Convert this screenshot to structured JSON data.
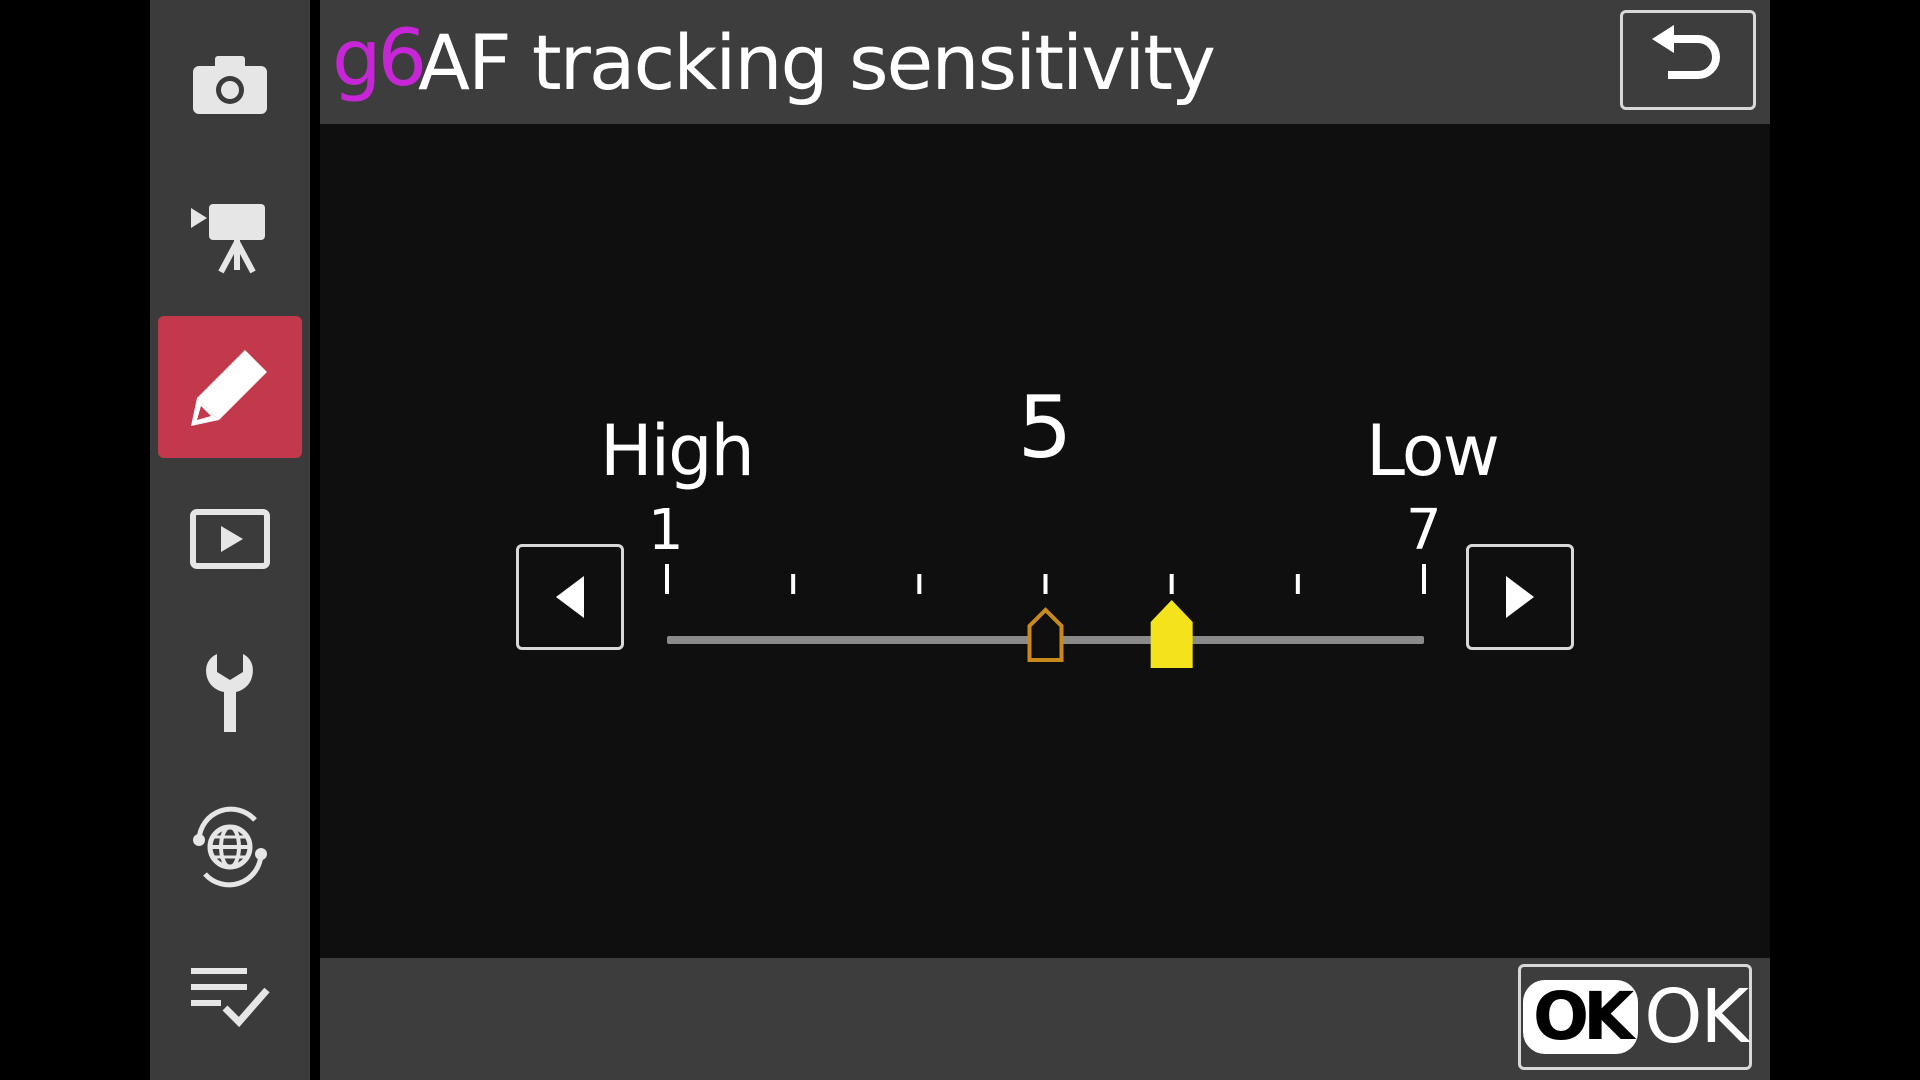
{
  "sidebar": {
    "items": [
      {
        "name": "camera-icon",
        "active": false
      },
      {
        "name": "movie-camera-icon",
        "active": false
      },
      {
        "name": "pencil-icon",
        "active": true
      },
      {
        "name": "playback-icon",
        "active": false
      },
      {
        "name": "wrench-icon",
        "active": false
      },
      {
        "name": "network-globe-icon",
        "active": false
      },
      {
        "name": "my-menu-icon",
        "active": false
      }
    ],
    "active_color": "#c1394b"
  },
  "header": {
    "code": "g6",
    "title": "AF tracking sensitivity",
    "code_color": "#c626d6",
    "back_icon": "return-arrow-icon"
  },
  "slider": {
    "label_high": "High",
    "label_low": "Low",
    "min_label": "1",
    "max_label": "7",
    "min": 1,
    "max": 7,
    "current_value": "5",
    "value": 5,
    "default_value": 4,
    "marker_color": "#f3e21c",
    "default_marker_color": "#c98a1c"
  },
  "footer": {
    "ok_badge": "OK",
    "ok_label": "OK"
  }
}
